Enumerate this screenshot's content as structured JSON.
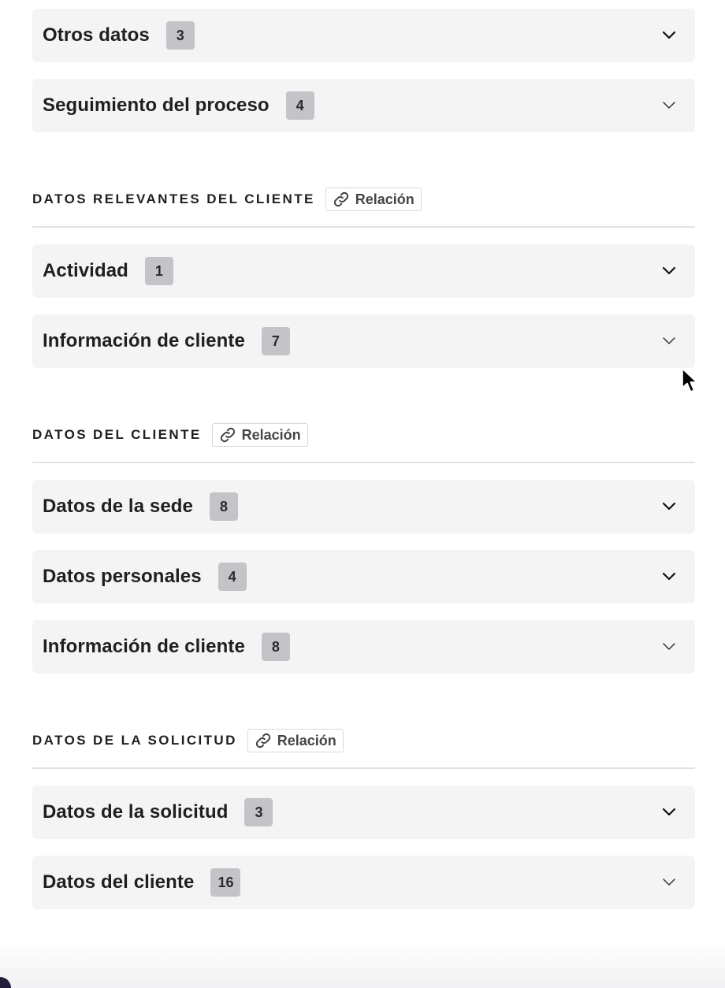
{
  "top_cards": [
    {
      "title": "Otros datos",
      "count": "3"
    },
    {
      "title": "Seguimiento del proceso",
      "count": "4"
    }
  ],
  "sections": [
    {
      "label": "DATOS RELEVANTES DEL CLIENTE",
      "relation_label": "Relación",
      "cards": [
        {
          "title": "Actividad",
          "count": "1"
        },
        {
          "title": "Información de cliente",
          "count": "7"
        }
      ]
    },
    {
      "label": "DATOS DEL CLIENTE",
      "relation_label": "Relación",
      "cards": [
        {
          "title": "Datos de la sede",
          "count": "8"
        },
        {
          "title": "Datos personales",
          "count": "4"
        },
        {
          "title": "Información de cliente",
          "count": "8"
        }
      ]
    },
    {
      "label": "DATOS DE LA SOLICITUD",
      "relation_label": "Relación",
      "cards": [
        {
          "title": "Datos de la solicitud",
          "count": "3"
        },
        {
          "title": "Datos del cliente",
          "count": "16"
        }
      ]
    }
  ],
  "icons": {
    "chevron": "chevron-down-icon",
    "link": "link-icon",
    "cursor": "mouse-pointer-icon"
  },
  "colors": {
    "card_bg": "#f4f4f4",
    "badge_bg": "#c4c4c8",
    "divider": "#e2e2e2"
  }
}
